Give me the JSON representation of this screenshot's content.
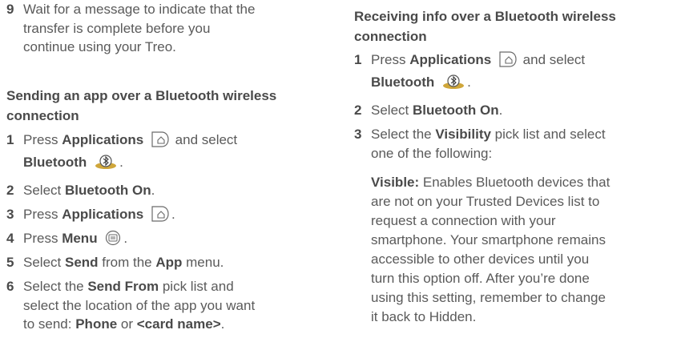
{
  "left": {
    "step9": {
      "num": "9",
      "text1": "Wait for a message to indicate that the",
      "text2": "transfer is complete before you",
      "text3": "continue using your Treo."
    },
    "heading": {
      "line1": "Sending an app over a Bluetooth wireless",
      "line2": "connection"
    },
    "steps": [
      {
        "num": "1",
        "a": "Press ",
        "b1": "Applications",
        "c": " and select",
        "b2": "Bluetooth",
        "d": "."
      },
      {
        "num": "2",
        "a": "Select ",
        "b1": "Bluetooth On",
        "c": "."
      },
      {
        "num": "3",
        "a": "Press ",
        "b1": "Applications",
        "c": "."
      },
      {
        "num": "4",
        "a": "Press ",
        "b1": "Menu",
        "c": "."
      },
      {
        "num": "5",
        "a": "Select ",
        "b1": "Send",
        "c": " from the ",
        "b2": "App",
        "d": " menu."
      },
      {
        "num": "6",
        "a": "Select the ",
        "b1": "Send From",
        "c": " pick list and",
        "line2": "select the location of the app you want",
        "line3a": "to send: ",
        "b2": "Phone",
        "line3b": " or ",
        "b3": "<card name>",
        "line3c": "."
      }
    ]
  },
  "right": {
    "heading": {
      "line1": "Receiving info over a Bluetooth wireless",
      "line2": "connection"
    },
    "steps": [
      {
        "num": "1",
        "a": "Press ",
        "b1": "Applications",
        "c": " and select",
        "b2": "Bluetooth",
        "d": "."
      },
      {
        "num": "2",
        "a": "Select ",
        "b1": "Bluetooth On",
        "c": "."
      },
      {
        "num": "3",
        "a": "Select the ",
        "b1": "Visibility",
        "c": " pick list and select",
        "line2": "one of the following:"
      }
    ],
    "visible": {
      "label": "Visible:",
      "l1": " Enables Bluetooth devices that",
      "l2": "are not on your Trusted Devices list to",
      "l3": "request a connection with your",
      "l4": "smartphone. Your smartphone remains",
      "l5": "accessible to other devices until you",
      "l6": "turn this option off. After you’re done",
      "l7": "using this setting, remember to change",
      "l8": "it back to Hidden."
    }
  },
  "icons": {
    "applications": "applications-key-icon",
    "bluetooth": "bluetooth-app-icon",
    "menu": "menu-key-icon"
  }
}
